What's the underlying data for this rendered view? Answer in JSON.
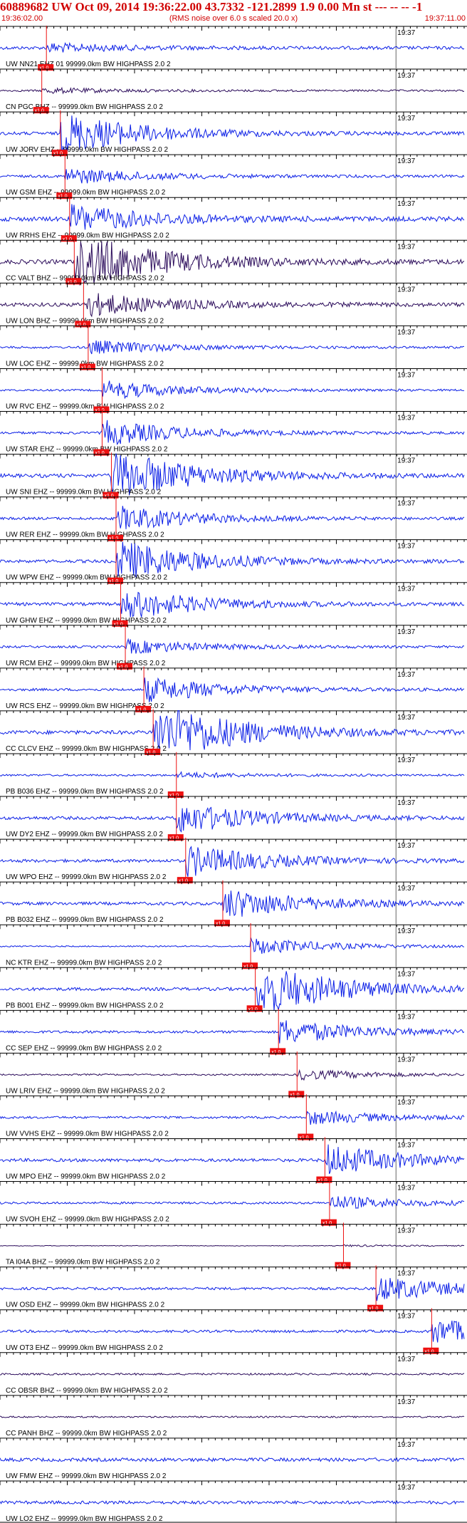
{
  "header": {
    "title": "60889682 UW Oct 09, 2014 19:36:22.00   43.7332  -121.2899  1.9 0.00 Mn st --- -- --   -1",
    "start_time": "19:36:02.00",
    "end_time": "19:37:11.00",
    "subtitle": "(RMS noise over 6.0 s scaled 20.0 x)"
  },
  "colors": {
    "header_text": "#d00000",
    "trace": "#0a1ee6",
    "trace_dark": "#2a0a5a",
    "pick": "#ee1111",
    "grid": "#000000"
  },
  "chart_data": {
    "type": "seismogram",
    "time_range": [
      "19:36:02.00",
      "19:37:11.00"
    ],
    "minute_label": "19:37",
    "pick_label": "x1.0",
    "traces": [
      {
        "label": "UW NN21 EHZ 01 99999.0km BW  HIGHPASS  2.0  2",
        "pick": 0.1,
        "color": "blue",
        "amp": 1.0,
        "burst": 0
      },
      {
        "label": "CN PGC BHZ -- 99999.0km BW  HIGHPASS  2.0  2",
        "pick": 0.09,
        "color": "dark",
        "amp": 0.6,
        "burst": 0
      },
      {
        "label": "UW JORV EHZ -- 99999.0km BW  HIGHPASS  2.0  2",
        "pick": 0.13,
        "color": "blue",
        "amp": 1.0,
        "burst": 3
      },
      {
        "label": "UW GSM EHZ -- 99999.0km BW  HIGHPASS  2.0  2",
        "pick": 0.14,
        "color": "blue",
        "amp": 0.8,
        "burst": 1
      },
      {
        "label": "UW RRHS EHZ -- 99999.0km BW  HIGHPASS  2.0  2",
        "pick": 0.15,
        "color": "blue",
        "amp": 1.4,
        "burst": 1
      },
      {
        "label": "CC VALT BHZ -- 99999.0km BW  HIGHPASS  2.0  2",
        "pick": 0.16,
        "color": "dark",
        "amp": 1.4,
        "burst": 3
      },
      {
        "label": "UW LON BHZ -- 99999.0km BW  HIGHPASS  2.0  2",
        "pick": 0.18,
        "color": "dark",
        "amp": 1.2,
        "burst": 1
      },
      {
        "label": "UW LOC EHZ -- 99999.0km BW  HIGHPASS  2.0  2",
        "pick": 0.19,
        "color": "blue",
        "amp": 0.7,
        "burst": 1
      },
      {
        "label": "UW RVC EHZ -- 99999.0km BW  HIGHPASS  2.0  2",
        "pick": 0.22,
        "color": "blue",
        "amp": 0.6,
        "burst": 2
      },
      {
        "label": "UW STAR EHZ -- 99999.0km BW  HIGHPASS  2.0  2",
        "pick": 0.22,
        "color": "blue",
        "amp": 0.8,
        "burst": 2
      },
      {
        "label": "UW SNI EHZ -- 99999.0km BW  HIGHPASS  2.0  2",
        "pick": 0.24,
        "color": "blue",
        "amp": 1.2,
        "burst": 3
      },
      {
        "label": "UW RER EHZ -- 99999.0km BW  HIGHPASS  2.0  2",
        "pick": 0.25,
        "color": "blue",
        "amp": 0.8,
        "burst": 2
      },
      {
        "label": "UW WPW EHZ -- 99999.0km BW  HIGHPASS  2.0  2",
        "pick": 0.25,
        "color": "blue",
        "amp": 1.0,
        "burst": 3
      },
      {
        "label": "UW GHW EHZ -- 99999.0km BW  HIGHPASS  2.0  2",
        "pick": 0.26,
        "color": "blue",
        "amp": 1.0,
        "burst": 2
      },
      {
        "label": "UW RCM EHZ -- 99999.0km BW  HIGHPASS  2.0  2",
        "pick": 0.27,
        "color": "blue",
        "amp": 0.7,
        "burst": 1
      },
      {
        "label": "UW RCS EHZ -- 99999.0km BW  HIGHPASS  2.0  2",
        "pick": 0.31,
        "color": "blue",
        "amp": 0.8,
        "burst": 2
      },
      {
        "label": "CC CLCV EHZ -- 99999.0km BW  HIGHPASS  2.0  2",
        "pick": 0.33,
        "color": "blue",
        "amp": 1.2,
        "burst": 4
      },
      {
        "label": "PB B036 EHZ -- 99999.0km BW  HIGHPASS  2.0  2",
        "pick": 0.38,
        "color": "blue",
        "amp": 0.6,
        "burst": 0
      },
      {
        "label": "UW DY2 EHZ -- 99999.0km BW  HIGHPASS  2.0  2",
        "pick": 0.38,
        "color": "blue",
        "amp": 1.0,
        "burst": 2
      },
      {
        "label": "UW WPO EHZ -- 99999.0km BW  HIGHPASS  2.0  2",
        "pick": 0.4,
        "color": "blue",
        "amp": 1.0,
        "burst": 2
      },
      {
        "label": "PB B032 EHZ -- 99999.0km BW  HIGHPASS  2.0  2",
        "pick": 0.48,
        "color": "blue",
        "amp": 1.0,
        "burst": 2
      },
      {
        "label": "NC KTR EHZ -- 99999.0km BW  HIGHPASS  2.0  2",
        "pick": 0.54,
        "color": "blue",
        "amp": 0.4,
        "burst": 3
      },
      {
        "label": "PB B001 EHZ -- 99999.0km BW  HIGHPASS  2.0  2",
        "pick": 0.55,
        "color": "blue",
        "amp": 1.0,
        "burst": 4
      },
      {
        "label": "CC SEP EHZ -- 99999.0km BW  HIGHPASS  2.0  2",
        "pick": 0.6,
        "color": "blue",
        "amp": 0.8,
        "burst": 2
      },
      {
        "label": "UW LRIV EHZ -- 99999.0km BW  HIGHPASS  2.0  2",
        "pick": 0.64,
        "color": "dark",
        "amp": 0.5,
        "burst": 1
      },
      {
        "label": "UW VVHS EHZ -- 99999.0km BW  HIGHPASS  2.0  2",
        "pick": 0.66,
        "color": "blue",
        "amp": 0.7,
        "burst": 1
      },
      {
        "label": "UW MPO EHZ -- 99999.0km BW  HIGHPASS  2.0  2",
        "pick": 0.7,
        "color": "blue",
        "amp": 1.0,
        "burst": 2
      },
      {
        "label": "UW SVOH EHZ -- 99999.0km BW  HIGHPASS  2.0  2",
        "pick": 0.71,
        "color": "blue",
        "amp": 0.7,
        "burst": 1
      },
      {
        "label": "TA I04A BHZ -- 99999.0km BW  HIGHPASS  2.0  2",
        "pick": 0.74,
        "color": "dark",
        "amp": 0.2,
        "burst": 0
      },
      {
        "label": "UW OSD EHZ -- 99999.0km BW  HIGHPASS  2.0  2",
        "pick": 0.81,
        "color": "blue",
        "amp": 0.8,
        "burst": 2
      },
      {
        "label": "UW OT3 EHZ -- 99999.0km BW  HIGHPASS  2.0  2",
        "pick": 0.93,
        "color": "blue",
        "amp": 0.8,
        "burst": 2
      },
      {
        "label": "CC OBSR BHZ -- 99999.0km BW  HIGHPASS  2.0  2",
        "pick": null,
        "color": "dark",
        "amp": 0.6,
        "burst": 0
      },
      {
        "label": "CC PANH BHZ -- 99999.0km BW  HIGHPASS  2.0  2",
        "pick": null,
        "color": "dark",
        "amp": 0.5,
        "burst": 0
      },
      {
        "label": "UW FMW EHZ -- 99999.0km BW  HIGHPASS  2.0  2",
        "pick": null,
        "color": "blue",
        "amp": 1.1,
        "burst": 1
      },
      {
        "label": "UW LO2 EHZ -- 99999.0km BW  HIGHPASS  2.0  2",
        "pick": null,
        "color": "blue",
        "amp": 1.0,
        "burst": 1
      }
    ]
  }
}
